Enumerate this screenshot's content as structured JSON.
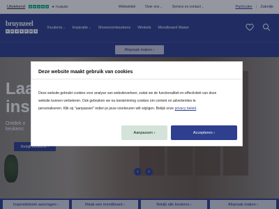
{
  "topbar": {
    "rating_label": "Uitstekend",
    "trustpilot_label": "Trustpilot",
    "links": [
      "Webwinkel",
      "Over ons",
      "Service en contact"
    ],
    "account_particulier": "Particulier",
    "account_separator": "|",
    "account_zakelijk": "Zakelijk"
  },
  "header": {
    "logo_text": "bruynzeel",
    "logo_sub": [
      "K",
      "E",
      "U",
      "K",
      "E",
      "N",
      "S"
    ],
    "nav": [
      {
        "label": "Keukens",
        "chevron": "⌄"
      },
      {
        "label": "Inspiratie",
        "chevron": "⌄"
      },
      {
        "label": "Showroomkeukens",
        "chevron": ""
      },
      {
        "label": "Winkels",
        "chevron": ""
      },
      {
        "label": "Moodboard Maker",
        "chevron": ""
      }
    ],
    "icons": [
      "heart-icon",
      "search-icon"
    ]
  },
  "appointment_bar": {
    "label": "Afspraak maken ›"
  },
  "hero": {
    "title_line1": "Laa",
    "title_line2": "insp",
    "subtitle_line1": "Ontdek o",
    "subtitle_line2": "keukenc",
    "cta": "Bekijk keukens ›",
    "prev": "‹",
    "next": "›"
  },
  "tiles": [
    "Inspiratieboek aanvragen ›",
    "Maak een moodboard ›",
    "Bekijk alle keukens ›",
    "Afspraak maken ›"
  ],
  "cookie_modal": {
    "title": "Deze website maakt gebruik van cookies",
    "body_line1": "Deze website gebruikt cookies voor analyse van websiteverkeer, zodat we de functionaliteit en effectiviteit van deze",
    "body_line2": "website kunnen verbeteren. Ook gebruiken we na toestemming cookies om content en advertenties te",
    "body_line3_pre": "personaliseren. Klik op \"aanpassen\" indien je jouw voorkeuren wilt wijzigen. Bekijk onze ",
    "body_line3_link": "privacy beleid",
    "body_line3_post": ".",
    "adjust_button": "Aanpassen ›",
    "accept_button": "Accepteren ›"
  },
  "colors": {
    "brand": "#2d3f8e",
    "trustpilot_green": "#00b67a",
    "adjust_bg": "#d3e3d9"
  }
}
